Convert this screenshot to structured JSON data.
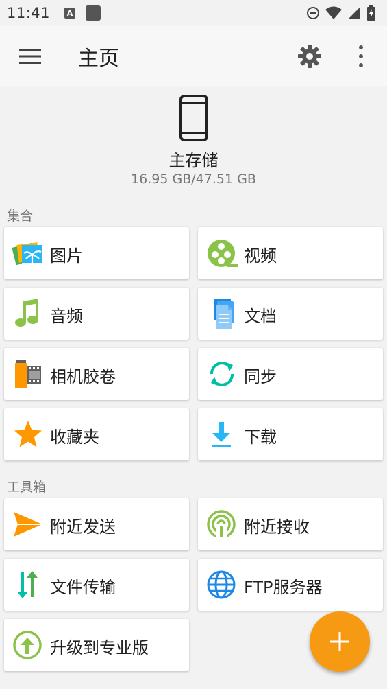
{
  "status_bar": {
    "time": "11:41"
  },
  "app_bar": {
    "title": "主页"
  },
  "storage": {
    "name": "主存储",
    "size": "16.95 GB/47.51 GB"
  },
  "sections": {
    "collections": "集合",
    "toolbox": "工具箱"
  },
  "collections": [
    {
      "label": "图片",
      "icon": "pictures-icon"
    },
    {
      "label": "视频",
      "icon": "video-icon"
    },
    {
      "label": "音频",
      "icon": "audio-icon"
    },
    {
      "label": "文档",
      "icon": "documents-icon"
    },
    {
      "label": "相机胶卷",
      "icon": "camera-roll-icon"
    },
    {
      "label": "同步",
      "icon": "sync-icon"
    },
    {
      "label": "收藏夹",
      "icon": "star-icon"
    },
    {
      "label": "下载",
      "icon": "download-icon"
    }
  ],
  "tools": [
    {
      "label": "附近发送",
      "icon": "send-icon"
    },
    {
      "label": "附近接收",
      "icon": "receive-icon"
    },
    {
      "label": "文件传输",
      "icon": "transfer-icon"
    },
    {
      "label": "FTP服务器",
      "icon": "globe-icon"
    },
    {
      "label": "升级到专业版",
      "icon": "upgrade-icon"
    }
  ],
  "colors": {
    "accent": "#f59a12",
    "green": "#8bc34a",
    "blue": "#2196f3",
    "teal": "#00bfa5"
  }
}
